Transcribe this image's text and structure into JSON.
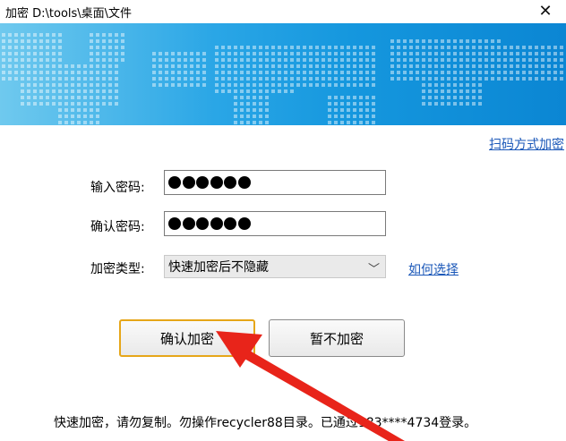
{
  "window": {
    "title": "加密 D:\\tools\\桌面\\文件"
  },
  "links": {
    "scan": "扫码方式加密",
    "how_to_choose": "如何选择"
  },
  "form": {
    "password_label": "输入密码:",
    "confirm_label": "确认密码:",
    "type_label": "加密类型:",
    "password_length": 6,
    "encryption_type_selected": "快速加密后不隐藏"
  },
  "buttons": {
    "confirm": "确认加密",
    "skip": "暂不加密"
  },
  "notice": "快速加密，请勿复制。勿操作recycler88目录。已通过183****4734登录。",
  "colors": {
    "banner": "#1597de",
    "link": "#1a57b8",
    "primary_border": "#e6a619",
    "arrow": "#e8241a"
  },
  "icons": {
    "close": "close-icon",
    "dropdown": "chevron-down-icon"
  }
}
